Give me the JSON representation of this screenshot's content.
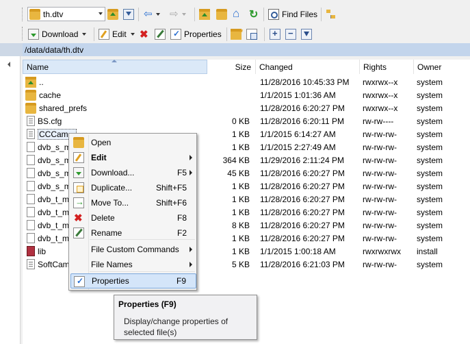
{
  "toolbar1": {
    "path_combo_value": "th.dtv",
    "find_files_label": "Find Files"
  },
  "toolbar2": {
    "download_label": "Download",
    "edit_label": "Edit",
    "properties_label": "Properties"
  },
  "path_bar": "/data/data/th.dtv",
  "columns": {
    "name": "Name",
    "size": "Size",
    "changed": "Changed",
    "rights": "Rights",
    "owner": "Owner"
  },
  "files": [
    {
      "name": "..",
      "icon": "parent-folder-icon",
      "size": "",
      "changed": "11/28/2016 10:45:33 PM",
      "rights": "rwxrwx--x",
      "owner": "system"
    },
    {
      "name": "cache",
      "icon": "folder-icon",
      "size": "",
      "changed": "1/1/2015 1:01:36 AM",
      "rights": "rwxrwx--x",
      "owner": "system"
    },
    {
      "name": "shared_prefs",
      "icon": "folder-icon",
      "size": "",
      "changed": "11/28/2016 6:20:27 PM",
      "rights": "rwxrwx--x",
      "owner": "system"
    },
    {
      "name": "BS.cfg",
      "icon": "text-file-icon",
      "size": "0 KB",
      "changed": "11/28/2016 6:20:11 PM",
      "rights": "rw-rw----",
      "owner": "system"
    },
    {
      "name": "CCCam...",
      "icon": "text-file-icon",
      "size": "1 KB",
      "changed": "1/1/2015 6:14:27 AM",
      "rights": "rw-rw-rw-",
      "owner": "system"
    },
    {
      "name": "dvb_s_m",
      "icon": "file-icon",
      "size": "1 KB",
      "changed": "1/1/2015 2:27:49 AM",
      "rights": "rw-rw-rw-",
      "owner": "system"
    },
    {
      "name": "dvb_s_m",
      "icon": "file-icon",
      "size": "364 KB",
      "changed": "11/29/2016 2:11:24 PM",
      "rights": "rw-rw-rw-",
      "owner": "system"
    },
    {
      "name": "dvb_s_m",
      "icon": "file-icon",
      "size": "45 KB",
      "changed": "11/28/2016 6:20:27 PM",
      "rights": "rw-rw-rw-",
      "owner": "system"
    },
    {
      "name": "dvb_s_m",
      "icon": "file-icon",
      "size": "1 KB",
      "changed": "11/28/2016 6:20:27 PM",
      "rights": "rw-rw-rw-",
      "owner": "system"
    },
    {
      "name": "dvb_t_m",
      "icon": "file-icon",
      "size": "1 KB",
      "changed": "11/28/2016 6:20:27 PM",
      "rights": "rw-rw-rw-",
      "owner": "system"
    },
    {
      "name": "dvb_t_m",
      "icon": "file-icon",
      "size": "1 KB",
      "changed": "11/28/2016 6:20:27 PM",
      "rights": "rw-rw-rw-",
      "owner": "system"
    },
    {
      "name": "dvb_t_m",
      "icon": "file-icon",
      "size": "8 KB",
      "changed": "11/28/2016 6:20:27 PM",
      "rights": "rw-rw-rw-",
      "owner": "system"
    },
    {
      "name": "dvb_t_m",
      "icon": "file-icon",
      "size": "1 KB",
      "changed": "11/28/2016 6:20:27 PM",
      "rights": "rw-rw-rw-",
      "owner": "system"
    },
    {
      "name": "lib",
      "icon": "link-file-icon",
      "size": "1 KB",
      "changed": "1/1/2015 1:00:18 AM",
      "rights": "rwxrwxrwx",
      "owner": "install"
    },
    {
      "name": "SoftCam",
      "icon": "text-file-icon",
      "size": "5 KB",
      "changed": "11/28/2016 6:21:03 PM",
      "rights": "rw-rw-rw-",
      "owner": "system"
    }
  ],
  "context_menu": [
    {
      "label": "Open",
      "key": "",
      "icon": "open-folder-icon",
      "bold": false,
      "submenu": false
    },
    {
      "label": "Edit",
      "key": "",
      "icon": "edit-icon",
      "bold": true,
      "submenu": true
    },
    {
      "label": "Download...",
      "key": "F5",
      "icon": "download-icon",
      "bold": false,
      "submenu": true
    },
    {
      "label": "Duplicate...",
      "key": "Shift+F5",
      "icon": "duplicate-icon",
      "bold": false,
      "submenu": false
    },
    {
      "label": "Move To...",
      "key": "Shift+F6",
      "icon": "move-icon",
      "bold": false,
      "submenu": false
    },
    {
      "label": "Delete",
      "key": "F8",
      "icon": "delete-icon",
      "bold": false,
      "submenu": false
    },
    {
      "label": "Rename",
      "key": "F2",
      "icon": "rename-icon",
      "bold": false,
      "submenu": false
    },
    {
      "label": "File Custom Commands",
      "key": "",
      "icon": "",
      "bold": false,
      "submenu": true
    },
    {
      "label": "File Names",
      "key": "",
      "icon": "",
      "bold": false,
      "submenu": true
    },
    {
      "label": "Properties",
      "key": "F9",
      "icon": "properties-icon",
      "bold": false,
      "submenu": false,
      "highlighted": true
    }
  ],
  "tooltip": {
    "title": "Properties (F9)",
    "body": "Display/change properties of selected file(s)"
  },
  "colors": {
    "path_bar_bg": "#c3d5ec",
    "highlight_bg": "#d4e5f9",
    "delete_red": "#d32020"
  }
}
